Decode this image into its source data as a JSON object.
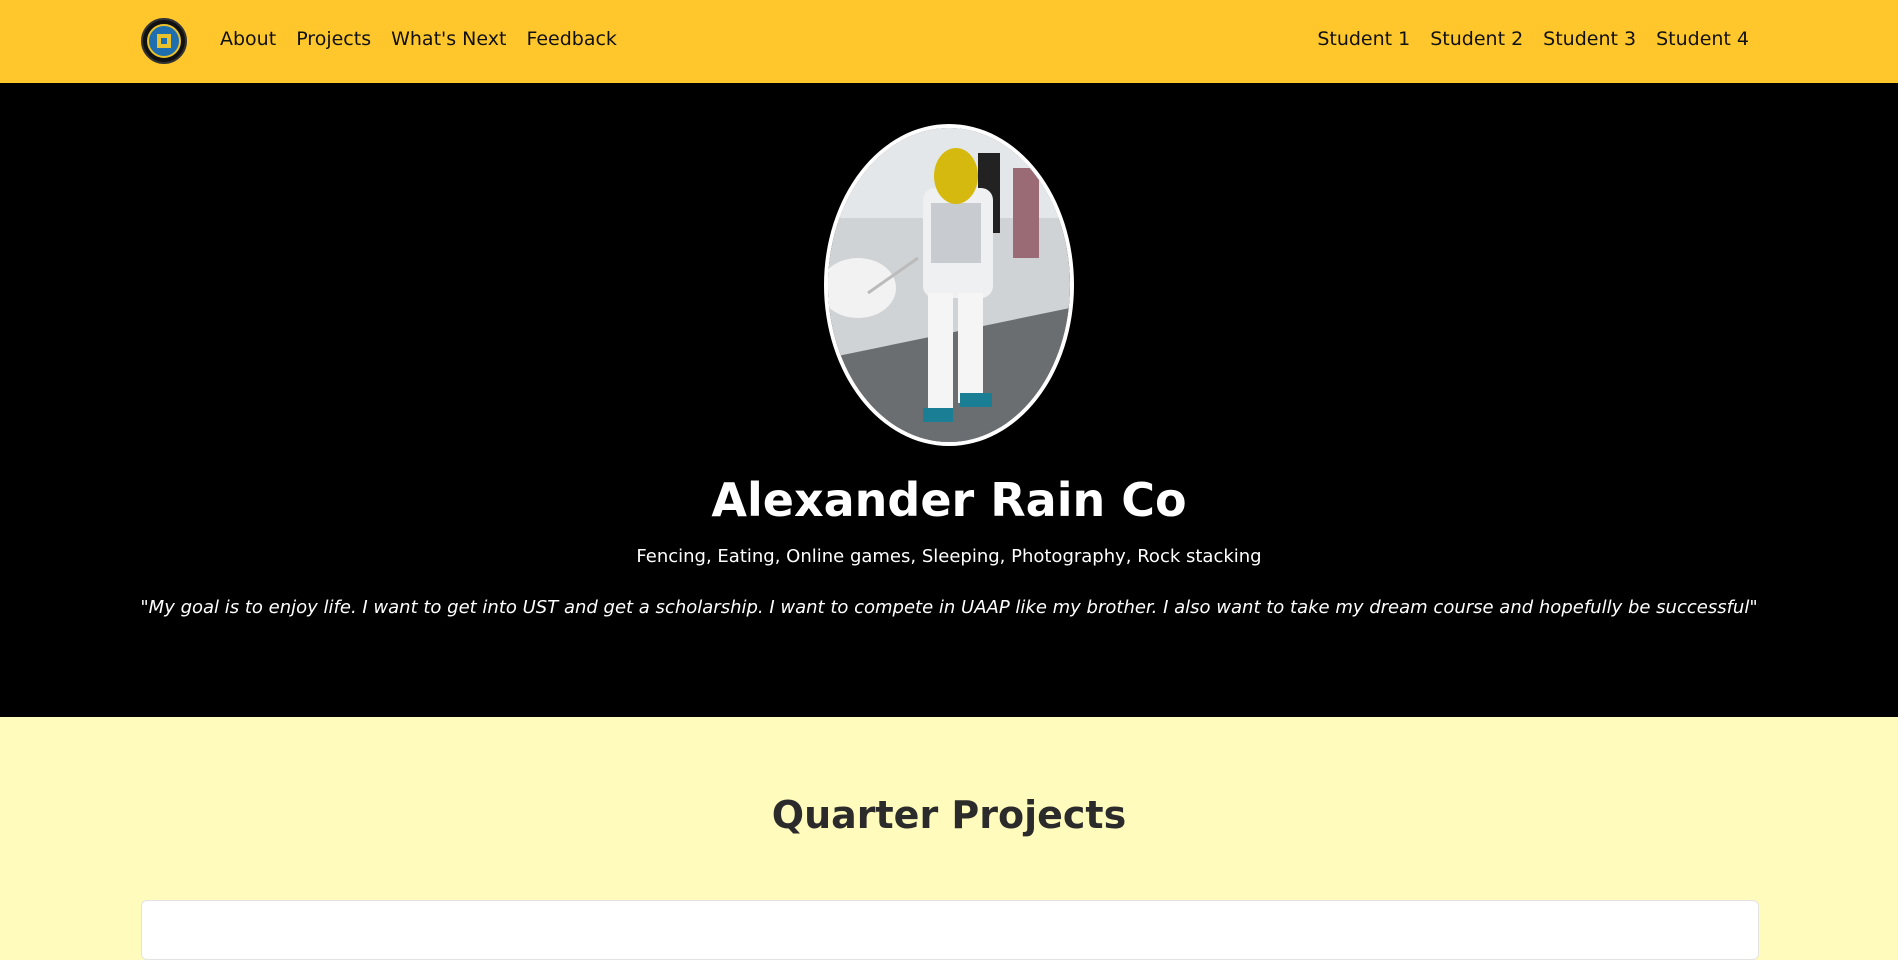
{
  "nav": {
    "logo_icon": "school-seal-icon",
    "left_links": [
      "About",
      "Projects",
      "What's Next",
      "Feedback"
    ],
    "right_links": [
      "Student 1",
      "Student 2",
      "Student 3",
      "Student 4"
    ]
  },
  "hero": {
    "name": "Alexander Rain Co",
    "hobbies": "Fencing, Eating, Online games, Sleeping, Photography, Rock stacking",
    "quote": "\"My goal is to enjoy life. I want to get into UST and get a scholarship. I want to compete in UAAP like my brother. I also want to take my dream course and hopefully be successful\""
  },
  "projects": {
    "title": "Quarter Projects"
  },
  "colors": {
    "nav_bg": "#ffc72c",
    "hero_bg": "#000000",
    "section_bg": "#fffbbd"
  }
}
